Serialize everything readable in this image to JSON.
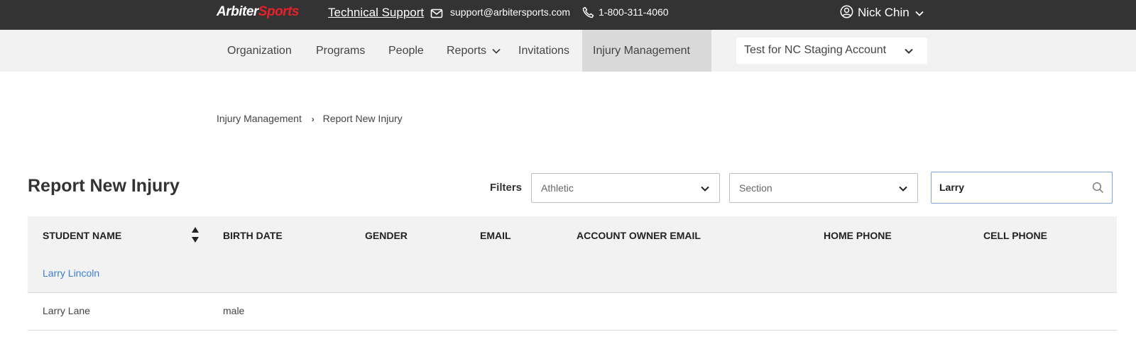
{
  "topbar": {
    "logo_part1": "Arbiter",
    "logo_part2": "Sports",
    "tech_support": "Technical Support",
    "email": "support@arbitersports.com",
    "phone": "1-800-311-4060",
    "user_name": "Nick Chin",
    "icons": [
      "mail-icon",
      "phone-icon",
      "user-circle-icon",
      "chevron-down-icon"
    ]
  },
  "nav": {
    "items": [
      {
        "label": "Organization"
      },
      {
        "label": "Programs"
      },
      {
        "label": "People"
      },
      {
        "label": "Reports"
      },
      {
        "label": "Invitations"
      },
      {
        "label": "Injury Management"
      }
    ],
    "active_item": "Injury Management",
    "account_selector": "Test for NC Staging Account"
  },
  "breadcrumb": {
    "items": [
      "Injury Management",
      "Report New Injury"
    ]
  },
  "page": {
    "title": "Report New Injury",
    "filters_label": "Filters",
    "filter_athletic": "Athletic",
    "filter_section": "Section",
    "search_value": "Larry"
  },
  "table": {
    "columns": [
      "STUDENT NAME",
      "BIRTH DATE",
      "GENDER",
      "EMAIL",
      "ACCOUNT OWNER EMAIL",
      "HOME PHONE",
      "CELL PHONE"
    ],
    "rows": [
      {
        "student_name": "Larry Lincoln",
        "birth_date": "",
        "gender": "",
        "email": "",
        "account_owner_email": "",
        "home_phone": "",
        "cell_phone": ""
      },
      {
        "student_name": "Larry Lane",
        "birth_date": "male",
        "gender": "",
        "email": "",
        "account_owner_email": "",
        "home_phone": "",
        "cell_phone": ""
      }
    ]
  },
  "colors": {
    "topbar_bg": "#333333",
    "nav_bg": "#f2f2f2",
    "nav_active_bg": "#d9d9d9",
    "brand_red": "#e8202a",
    "link_blue": "#3d7ed6",
    "search_border": "#7aa7d8"
  }
}
